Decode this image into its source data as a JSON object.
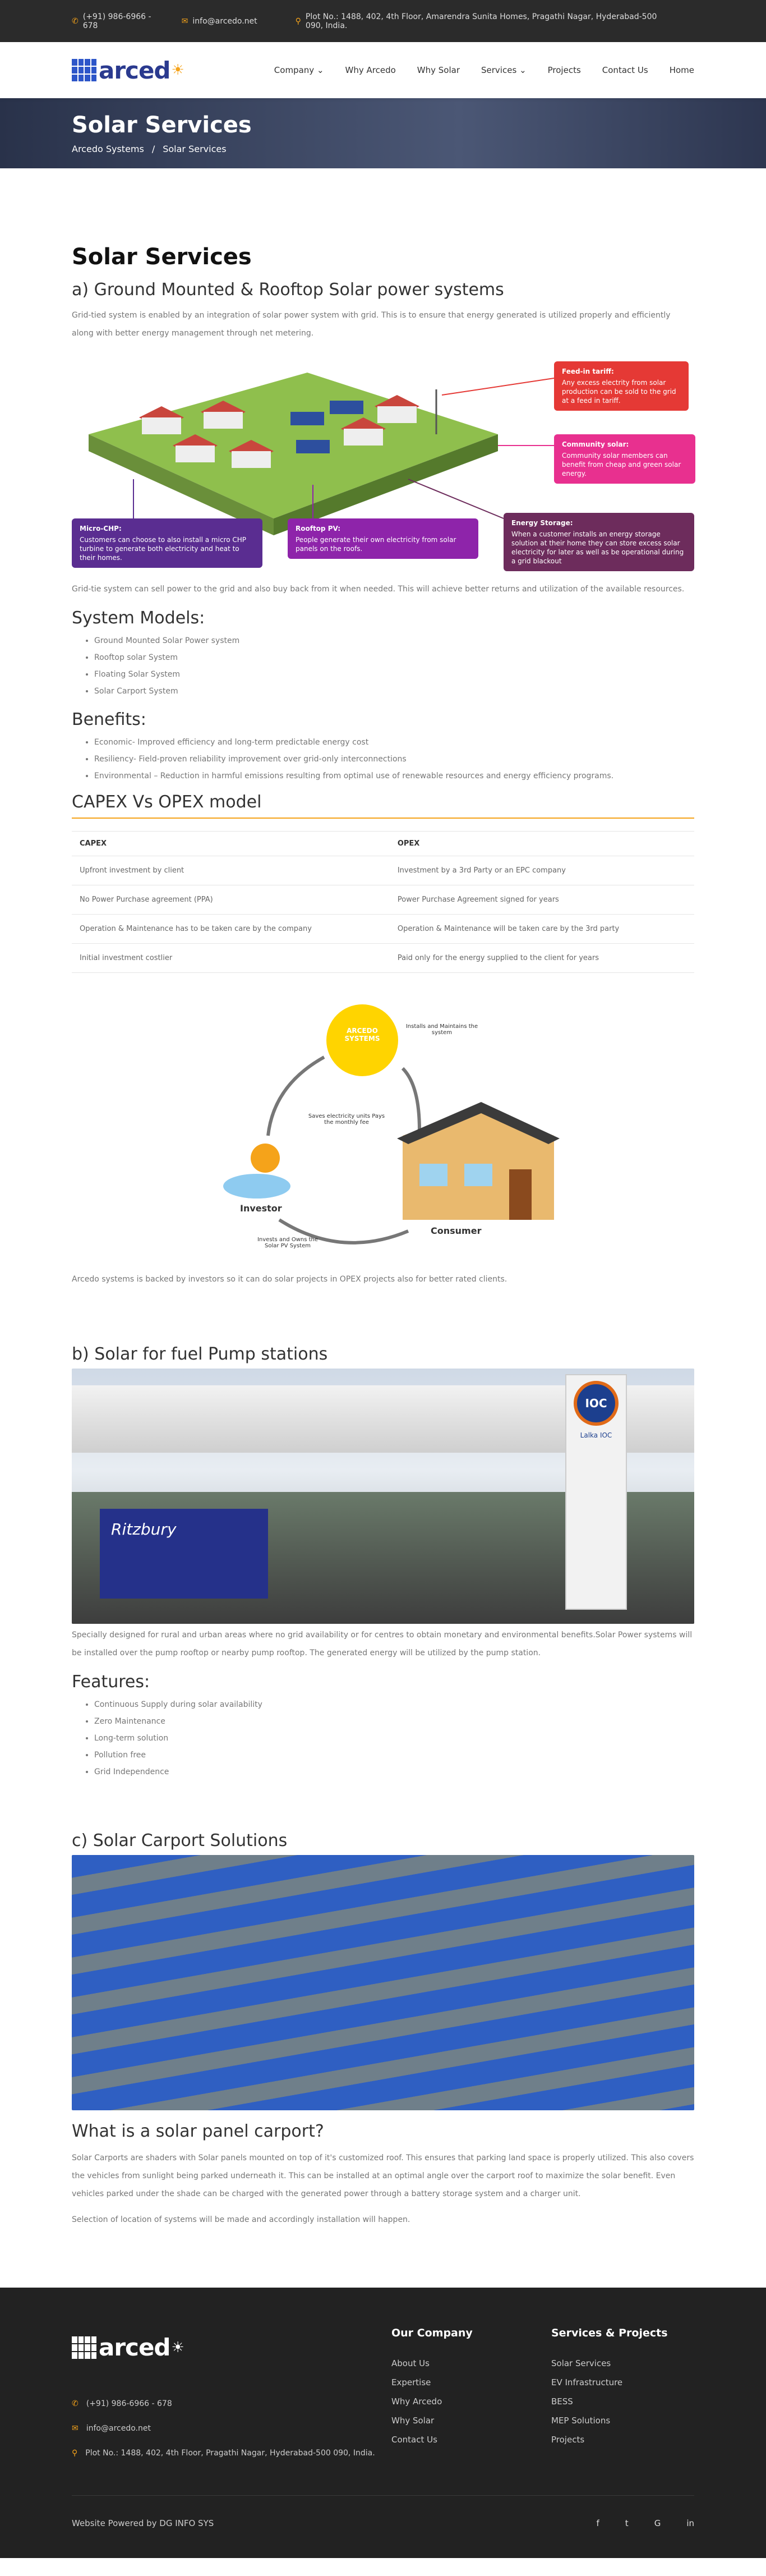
{
  "topbar": {
    "phone": "(+91) 986-6966 - 678",
    "email": "info@arcedo.net",
    "address": "Plot No.: 1488, 402, 4th Floor, Amarendra Sunita Homes, Pragathi Nagar, Hyderabad-500 090, India."
  },
  "header": {
    "logo_text": "arced",
    "nav": [
      "Company",
      "Why Arcedo",
      "Why Solar",
      "Services",
      "Projects",
      "Contact Us",
      "Home"
    ]
  },
  "hero": {
    "title": "Solar Services",
    "crumb_home": "Arcedo Systems",
    "crumb_sep": "/",
    "crumb_current": "Solar Services"
  },
  "main": {
    "title": "Solar Services",
    "section_a": "a) Ground Mounted & Rooftop Solar power systems",
    "intro": "Grid-tied system is enabled by an integration of solar power system with grid. This is to ensure that energy generated is utilized properly and efficiently along with better energy management through net metering.",
    "callouts": {
      "feed_title": "Feed-in tariff:",
      "feed_text": "Any excess electrity from solar production can be sold to the grid at a feed in tariff.",
      "community_title": "Community solar:",
      "community_text": "Community solar members can benefit from cheap and green solar energy.",
      "chp_title": "Micro-CHP:",
      "chp_text": "Customers can choose to also install a micro CHP turbine to generate both electricity and heat to their homes.",
      "rooftop_title": "Rooftop PV:",
      "rooftop_text": "People generate their own electricity from solar panels on the roofs.",
      "storage_title": "Energy Storage:",
      "storage_text": "When a customer installs an energy storage solution at their home they can store excess solar electricity for later as well as be operational during a grid blackout"
    },
    "grid_note": "Grid-tie system can sell power to the grid and also buy back from it when needed. This will achieve better returns and utilization of the available resources.",
    "models_title": "System Models:",
    "models": [
      "Ground Mounted Solar Power system",
      "Rooftop solar System",
      "Floating Solar System",
      "Solar Carport System"
    ],
    "benefits_title": "Benefits:",
    "benefits": [
      "Economic- Improved efficiency and long-term predictable energy cost",
      "Resiliency- Field-proven reliability improvement over grid-only interconnections",
      "Environmental – Reduction in harmful emissions resulting from optimal use of renewable resources and energy efficiency programs."
    ],
    "capex_title": "CAPEX Vs OPEX model",
    "table_headers": [
      "CAPEX",
      "OPEX"
    ],
    "table_rows": [
      [
        "Upfront investment by client",
        "Investment by a 3rd Party or an EPC company"
      ],
      [
        "No Power Purchase agreement (PPA)",
        "Power Purchase Agreement signed for years"
      ],
      [
        "Operation & Maintenance has to be taken care by the company",
        "Operation & Maintenance will be taken care by the 3rd party"
      ],
      [
        "Initial investment costlier",
        "Paid only for the energy supplied to the client for years"
      ]
    ],
    "opex_diagram": {
      "arcedo": "ARCEDO SYSTEMS",
      "installs": "Installs and Maintains the system",
      "saves": "Saves electricity units Pays the monthly fee",
      "investor": "Investor",
      "consumer": "Consumer",
      "invests": "Invests and Owns the Solar PV System"
    },
    "opex_note": "Arcedo systems is backed by investors so it can do solar projects in OPEX projects also for better rated clients.",
    "section_b": "b) Solar for fuel Pump stations",
    "fuel_text": "Specially designed for rural and urban areas where no grid availability or for centres to obtain monetary and environmental benefits.Solar Power systems will be installed over the pump rooftop or nearby pump rooftop. The generated energy will be utilized by the pump station.",
    "fuel_sign": "IOC",
    "fuel_sign_sub": "Lalka IOC",
    "fuel_truck": "Ritzbury",
    "features_title": "Features:",
    "features": [
      "Continuous Supply during solar availability",
      "Zero Maintenance",
      "Long-term solution",
      "Pollution free",
      "Grid Independence"
    ],
    "section_c": "c) Solar Carport Solutions",
    "carport_q": "What is a solar panel carport?",
    "carport_text": "Solar Carports are shaders with Solar panels mounted on top of it's customized roof. This ensures that parking land space is properly utilized. This also covers the vehicles from sunlight being parked underneath it. This can be installed at an optimal angle over the carport roof to maximize the solar benefit. Even vehicles parked under the shade can be charged with the generated power through a battery storage system and a charger unit.",
    "carport_note": "Selection of location of systems will be made and accordingly installation will happen."
  },
  "footer": {
    "phone": "(+91) 986-6966 - 678",
    "email": "info@arcedo.net",
    "address": "Plot No.: 1488, 402, 4th Floor, Pragathi Nagar, Hyderabad-500 090, India.",
    "company_title": "Our Company",
    "company_links": [
      "About Us",
      "Expertise",
      "Why Arcedo",
      "Why Solar",
      "Contact Us"
    ],
    "services_title": "Services & Projects",
    "services_links": [
      "Solar Services",
      "EV Infrastructure",
      "BESS",
      "MEP Solutions",
      "Projects"
    ],
    "powered": "Website Powered by DG INFO SYS",
    "social": [
      "f",
      "t",
      "G",
      "in"
    ]
  },
  "colors": {
    "accent": "#f5a31a",
    "brand": "#2a3a8f",
    "feed": "#e53935",
    "community": "#e8308f",
    "chp": "#5a2d91",
    "rooftop": "#8e24aa",
    "storage": "#6d2c5c"
  }
}
